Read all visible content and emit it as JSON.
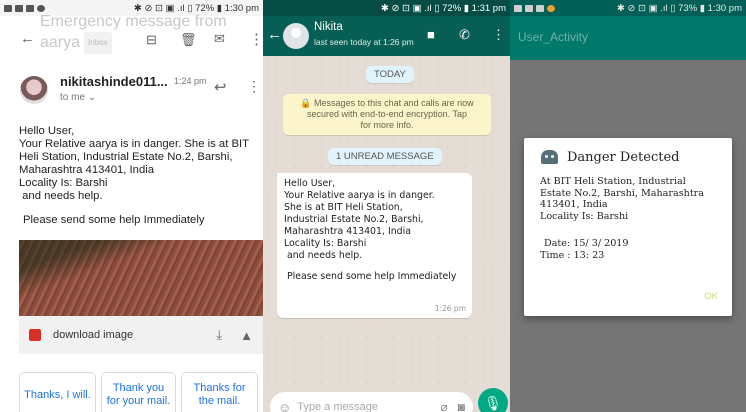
{
  "gmail": {
    "status": {
      "icons": [
        "message-icon",
        "sync-icon",
        "image-icon",
        "record-icon"
      ],
      "right": "✱ ⊘ ⊡ ▣ .ıl ▯ 72% ▮ 1:30 pm"
    },
    "subject_line1": "Emergency message from",
    "subject_line2": "aarya",
    "inbox_label": "Inbox",
    "sender": "nikitashinde011...",
    "time": "1:24 pm",
    "to": "to me",
    "body": [
      "Hello User,",
      "Your Relative aarya is in danger. She is at BIT",
      "Heli Station, Industrial Estate No.2, Barshi,",
      "Maharashtra 413401, India",
      "Locality Is: Barshi",
      " and needs help."
    ],
    "body_last": "Please send some help Immediately",
    "attachment_label": "download image",
    "smart_replies": [
      "Thanks, I will.",
      "Thank you for your mail.",
      "Thanks for the mail."
    ]
  },
  "whatsapp": {
    "status_right": "✱ ⊘ ⊡ ▣ .ıl ▯ 72% ▮ 1:31 pm",
    "contact": "Nikita",
    "last_seen": "last seen today at 1:26 pm",
    "date_chip": "TODAY",
    "encryption": [
      "🔒 Messages to this chat and calls are now",
      "secured with end-to-end encryption. Tap",
      "for more info."
    ],
    "unread_chip": "1 UNREAD MESSAGE",
    "message": [
      "Hello User,",
      "Your Relative aarya is in danger.",
      "She is at BIT Heli Station,",
      "Industrial Estate No.2, Barshi,",
      "Maharashtra 413401, India",
      "Locality Is: Barshi",
      " and needs help."
    ],
    "message_last": "Please send some help Immediately",
    "message_time": "1:26 pm",
    "input_placeholder": "Type a message"
  },
  "app": {
    "status_right": "✱ ⊘ ⊡ ▣ .ıl ▯ 73% ▮ 1:30 pm",
    "title": "User_Activity",
    "dialog": {
      "title": "Danger Detected",
      "body": [
        "At BIT Heli Station, Industrial",
        "Estate No.2, Barshi, Maharashtra",
        "413401, India",
        "Locality Is: Barshi"
      ],
      "date": "Date: 15/ 3/ 2019",
      "time": "Time : 13: 23",
      "ok": "OK"
    }
  },
  "colors": {
    "wa_header": "#075e54",
    "app_bar": "#00796b",
    "accent": "#00a884"
  }
}
